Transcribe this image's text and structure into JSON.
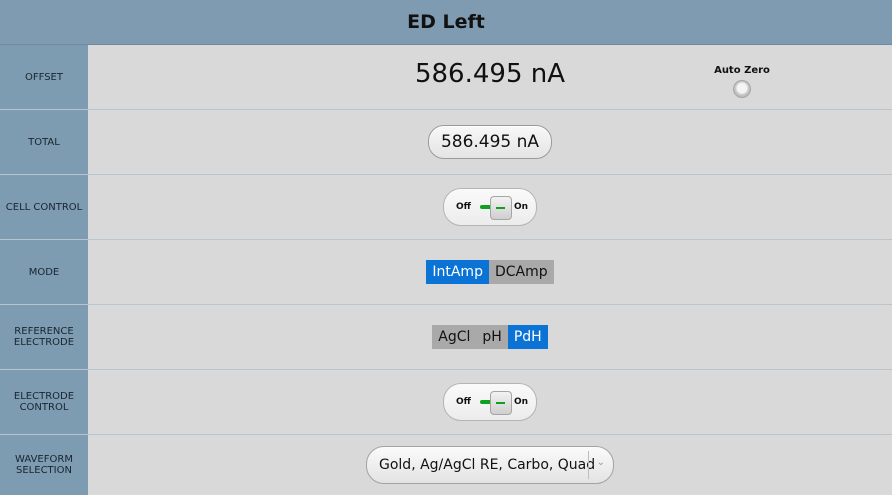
{
  "header": {
    "title": "ED Left"
  },
  "rows": {
    "offset": {
      "label": "OFFSET",
      "value": "586.495 nA",
      "auto_zero_label": "Auto Zero"
    },
    "total": {
      "label": "TOTAL",
      "value": "586.495 nA"
    },
    "cell_control": {
      "label": "CELL CONTROL",
      "off_label": "Off",
      "on_label": "On"
    },
    "mode": {
      "label": "MODE",
      "options": [
        "IntAmp",
        "DCAmp"
      ],
      "selected": "IntAmp"
    },
    "reference_electrode": {
      "label": "REFERENCE\nELECTRODE",
      "options": [
        "AgCl",
        "pH",
        "PdH"
      ],
      "selected": "PdH"
    },
    "electrode_control": {
      "label": "ELECTRODE\nCONTROL",
      "off_label": "Off",
      "on_label": "On"
    },
    "waveform_selection": {
      "label": "WAVEFORM\nSELECTION",
      "value": "Gold, Ag/AgCl RE, Carbo, Quad"
    }
  },
  "colors": {
    "header_bg": "#7e9bb1",
    "label_bg": "#7d9bb1",
    "selected_accent": "#0b73d6",
    "toggle_green": "#10a020"
  },
  "icons": {
    "auto_zero": "radio-button-icon",
    "dropdown": "chevron-down-icon"
  }
}
